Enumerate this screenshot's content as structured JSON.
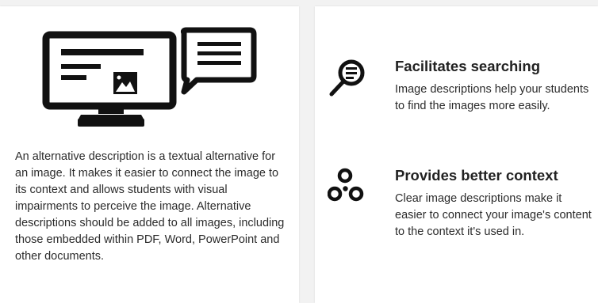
{
  "left_card": {
    "icon": "monitor-with-speech-bubble-icon",
    "description": "An alternative description is a textual alternative for an image. It makes it easier to connect the image to its context and allows students with visual impairments to perceive the image. Alternative descriptions should be added to all images, including those embedded within PDF, Word, PowerPoint and other documents."
  },
  "right_card": {
    "features": [
      {
        "icon": "magnifier-text-icon",
        "title": "Facilitates searching",
        "text": "Image descriptions help your students to find the images more easily."
      },
      {
        "icon": "connected-circles-icon",
        "title": "Provides better context",
        "text": "Clear image descriptions make it easier to connect your image's content to the context it's used in."
      }
    ]
  },
  "colors": {
    "icon": "#111111",
    "text": "#2b2b2b",
    "card_background": "#ffffff",
    "page_background": "#f2f2f2"
  }
}
